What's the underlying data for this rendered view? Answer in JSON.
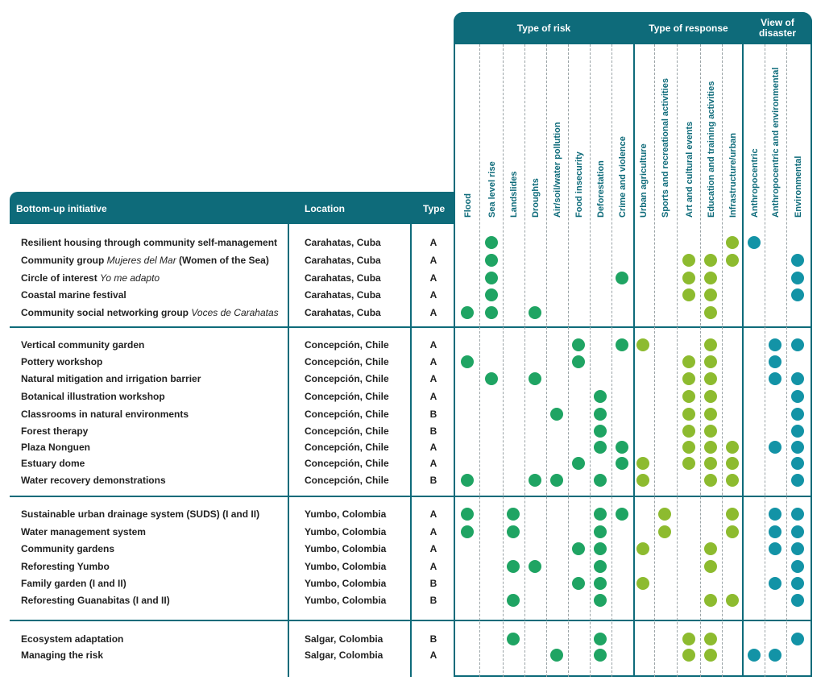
{
  "colors": {
    "header": "#0e6b7a",
    "risk": "#1fa463",
    "response": "#8dbb2f",
    "view": "#1393a6"
  },
  "header": {
    "initiative": "Bottom-up initiative",
    "location": "Location",
    "type": "Type",
    "group_risk": "Type of risk",
    "group_response": "Type of response",
    "group_view": "View of disaster"
  },
  "columns": [
    "Flood",
    "Sea level rise",
    "Landslides",
    "Droughts",
    "Air/soil/water pollution",
    "Food insecurity",
    "Deforestation",
    "Crime and violence",
    "Urban agriculture",
    "Sports and recreational activities",
    "Art and cultural events",
    "Education and training activities",
    "Infrastructure/urban",
    "Anthropocentric",
    "Anthropocentric and environmental",
    "Environmental"
  ],
  "rows": [
    {
      "name": "Resilient housing through community self-management",
      "name_italic": "",
      "name_suffix": "",
      "location": "Carahatas, Cuba",
      "type": "A",
      "marks": [
        1,
        12,
        13
      ]
    },
    {
      "name": "Community group ",
      "name_italic": "Mujeres del Mar",
      "name_suffix": " (Women of the Sea)",
      "location": "Carahatas, Cuba",
      "type": "A",
      "marks": [
        1,
        10,
        11,
        12,
        15
      ]
    },
    {
      "name": "Circle of interest ",
      "name_italic": "Yo me adapto",
      "name_suffix": "",
      "location": "Carahatas, Cuba",
      "type": "A",
      "marks": [
        1,
        7,
        10,
        11,
        15
      ]
    },
    {
      "name": "Coastal marine festival",
      "name_italic": "",
      "name_suffix": "",
      "location": "Carahatas, Cuba",
      "type": "A",
      "marks": [
        1,
        10,
        11,
        15
      ]
    },
    {
      "name": "Community social networking group ",
      "name_italic": "Voces de Carahatas",
      "name_suffix": "",
      "location": "Carahatas, Cuba",
      "type": "A",
      "marks": [
        0,
        1,
        3,
        11
      ]
    },
    {
      "name": "Vertical community garden",
      "name_italic": "",
      "name_suffix": "",
      "location": "Concepción, Chile",
      "type": "A",
      "marks": [
        5,
        7,
        8,
        11,
        14,
        15
      ]
    },
    {
      "name": "Pottery workshop",
      "name_italic": "",
      "name_suffix": "",
      "location": "Concepción, Chile",
      "type": "A",
      "marks": [
        0,
        5,
        10,
        11,
        14
      ]
    },
    {
      "name": "Natural mitigation and irrigation barrier",
      "name_italic": "",
      "name_suffix": "",
      "location": "Concepción, Chile",
      "type": "A",
      "marks": [
        1,
        3,
        10,
        11,
        14,
        15
      ]
    },
    {
      "name": "Botanical illustration workshop",
      "name_italic": "",
      "name_suffix": "",
      "location": "Concepción, Chile",
      "type": "A",
      "marks": [
        6,
        10,
        11,
        15
      ]
    },
    {
      "name": "Classrooms in natural environments",
      "name_italic": "",
      "name_suffix": "",
      "location": "Concepción, Chile",
      "type": "B",
      "marks": [
        4,
        6,
        10,
        11,
        15
      ]
    },
    {
      "name": "Forest therapy",
      "name_italic": "",
      "name_suffix": "",
      "location": "Concepción, Chile",
      "type": "B",
      "marks": [
        6,
        10,
        11,
        15
      ]
    },
    {
      "name": "Plaza Nonguen",
      "name_italic": "",
      "name_suffix": "",
      "location": "Concepción, Chile",
      "type": "A",
      "marks": [
        6,
        7,
        10,
        11,
        12,
        14,
        15
      ]
    },
    {
      "name": "Estuary dome",
      "name_italic": "",
      "name_suffix": "",
      "location": "Concepción, Chile",
      "type": "A",
      "marks": [
        5,
        7,
        8,
        10,
        11,
        12,
        15
      ]
    },
    {
      "name": "Water recovery demonstrations",
      "name_italic": "",
      "name_suffix": "",
      "location": "Concepción, Chile",
      "type": "B",
      "marks": [
        0,
        3,
        4,
        6,
        8,
        11,
        12,
        15
      ]
    },
    {
      "name": "Sustainable urban drainage system (SUDS) (I and II)",
      "name_italic": "",
      "name_suffix": "",
      "location": "Yumbo, Colombia",
      "type": "A",
      "marks": [
        0,
        2,
        6,
        7,
        9,
        12,
        14,
        15
      ]
    },
    {
      "name": "Water management system",
      "name_italic": "",
      "name_suffix": "",
      "location": "Yumbo, Colombia",
      "type": "A",
      "marks": [
        0,
        2,
        6,
        9,
        12,
        14,
        15
      ]
    },
    {
      "name": "Community gardens",
      "name_italic": "",
      "name_suffix": "",
      "location": "Yumbo, Colombia",
      "type": "A",
      "marks": [
        5,
        6,
        8,
        11,
        14,
        15
      ]
    },
    {
      "name": "Reforesting Yumbo",
      "name_italic": "",
      "name_suffix": "",
      "location": "Yumbo, Colombia",
      "type": "A",
      "marks": [
        2,
        3,
        6,
        11,
        15
      ]
    },
    {
      "name": "Family garden (I and II)",
      "name_italic": "",
      "name_suffix": "",
      "location": "Yumbo, Colombia",
      "type": "B",
      "marks": [
        5,
        6,
        8,
        14,
        15
      ]
    },
    {
      "name": "Reforesting Guanabitas (I and II)",
      "name_italic": "",
      "name_suffix": "",
      "location": "Yumbo, Colombia",
      "type": "B",
      "marks": [
        2,
        6,
        11,
        12,
        15
      ]
    },
    {
      "name": "Ecosystem adaptation",
      "name_italic": "",
      "name_suffix": "",
      "location": "Salgar, Colombia",
      "type": "B",
      "marks": [
        2,
        6,
        10,
        11,
        15
      ]
    },
    {
      "name": "Managing the risk",
      "name_italic": "",
      "name_suffix": "",
      "location": "Salgar, Colombia",
      "type": "A",
      "marks": [
        4,
        6,
        10,
        11,
        13,
        14
      ]
    }
  ]
}
